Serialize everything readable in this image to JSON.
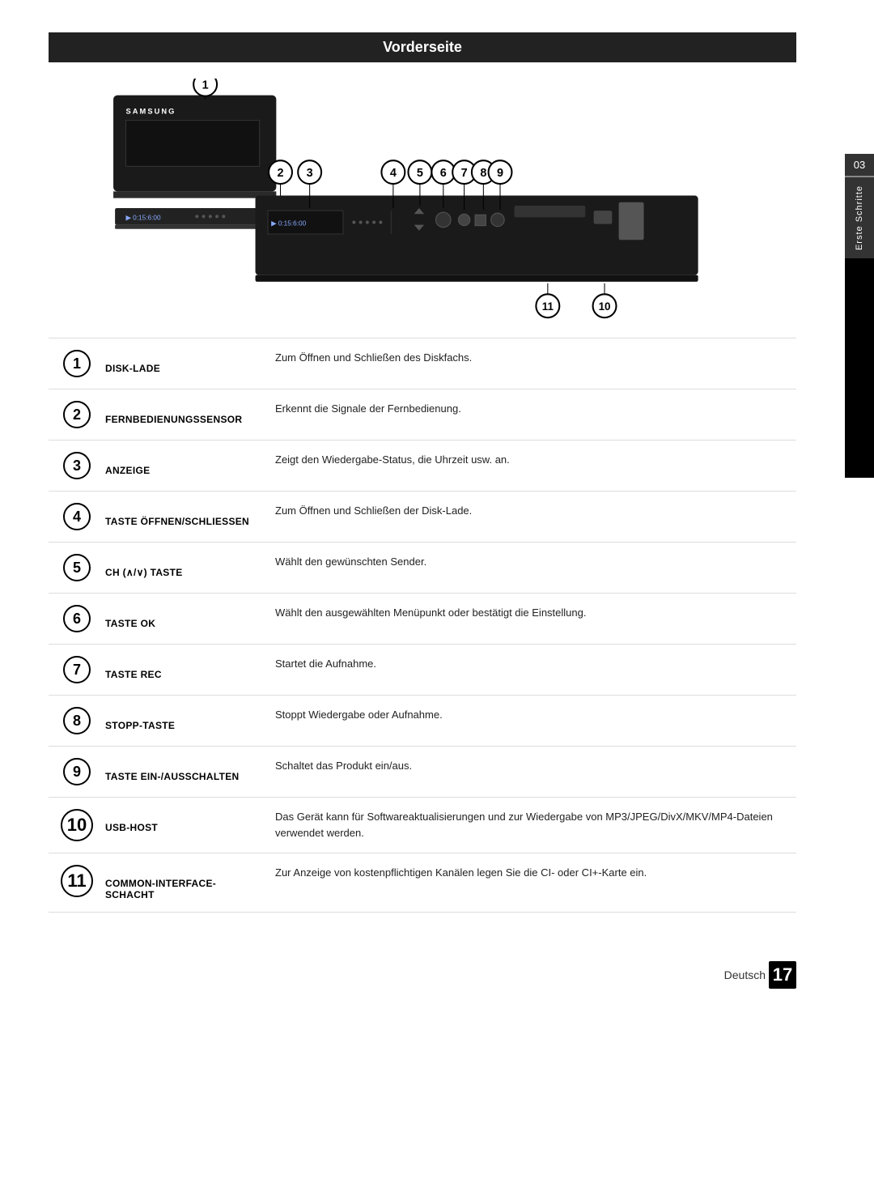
{
  "page": {
    "title": "Vorderseite",
    "language": "Deutsch",
    "page_number": "17",
    "section_number": "03",
    "section_label": "Erste Schritte"
  },
  "items": [
    {
      "number": "1",
      "label": "DISK-LADE",
      "description": "Zum Öffnen und Schließen des Diskfachs.",
      "size": "small"
    },
    {
      "number": "2",
      "label": "FERNBEDIENUNGSSENSOR",
      "description": "Erkennt die Signale der Fernbedienung.",
      "size": "small"
    },
    {
      "number": "3",
      "label": "ANZEIGE",
      "description": "Zeigt den Wiedergabe-Status, die Uhrzeit usw. an.",
      "size": "small"
    },
    {
      "number": "4",
      "label": "TASTE ÖFFNEN/SCHLIESSEN",
      "description": "Zum Öffnen und Schließen der Disk-Lade.",
      "size": "small"
    },
    {
      "number": "5",
      "label": "CH (∧/∨) TASTE",
      "description": "Wählt den gewünschten Sender.",
      "size": "small"
    },
    {
      "number": "6",
      "label": "TASTE OK",
      "description": "Wählt den ausgewählten Menüpunkt oder bestätigt die Einstellung.",
      "size": "small"
    },
    {
      "number": "7",
      "label": "TASTE REC",
      "description": "Startet die Aufnahme.",
      "size": "small"
    },
    {
      "number": "8",
      "label": "STOPP-TASTE",
      "description": "Stoppt Wiedergabe oder Aufnahme.",
      "size": "small"
    },
    {
      "number": "9",
      "label": "TASTE EIN-/AUSSCHALTEN",
      "description": "Schaltet das Produkt ein/aus.",
      "size": "small"
    },
    {
      "number": "10",
      "label": "USB-HOST",
      "description": "Das Gerät kann für Softwareaktualisierungen und zur Wiedergabe von MP3/JPEG/DivX/MKV/MP4-Dateien verwendet werden.",
      "size": "large"
    },
    {
      "number": "11",
      "label": "COMMON-INTERFACE-\nSCHACHT",
      "description": "Zur Anzeige von kostenpflichtigen Kanälen legen Sie die CI- oder CI+-Karte ein.",
      "size": "large"
    }
  ]
}
